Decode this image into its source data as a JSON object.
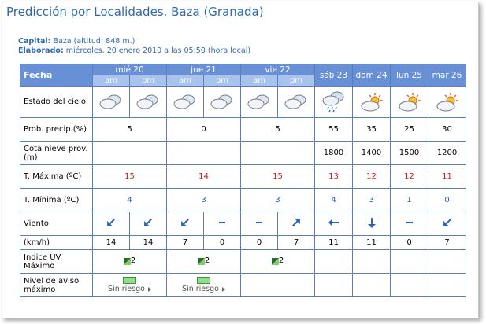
{
  "page": {
    "title": "Predicción por Localidades. Baza (Granada)",
    "capital_label": "Capital:",
    "capital_value": "Baza (altitud: 848 m.)",
    "elaborado_label": "Elaborado:",
    "elaborado_value": "miércoles, 20 enero 2010 a las 05:50 (hora local)"
  },
  "table": {
    "fecha_label": "Fecha",
    "split_days": [
      {
        "label": "mié 20",
        "am": "am",
        "pm": "pm"
      },
      {
        "label": "jue 21",
        "am": "am",
        "pm": "pm"
      },
      {
        "label": "vie 22",
        "am": "am",
        "pm": "pm"
      }
    ],
    "single_days": [
      "sáb 23",
      "dom 24",
      "lun 25",
      "mar 26"
    ],
    "row_labels": {
      "sky": "Estado del cielo",
      "precip": "Prob. precip.(%)",
      "snow": "Cota nieve prov.(m)",
      "tmax": "T. Máxima (ºC)",
      "tmin": "T. Mínima (ºC)",
      "wind": "Viento",
      "kmh": "(km/h)",
      "uv": "Indice UV Máximo",
      "warn": "Nivel de aviso máximo"
    },
    "sky_icons": [
      "cloudy-icon",
      "cloudy-icon",
      "cloudy-icon",
      "cloudy-icon",
      "cloudy-icon",
      "cloudy-icon",
      "cloudy-rain-icon",
      "partly-cloudy-sun-icon",
      "partly-cloudy-sun-icon",
      "partly-cloudy-sun-icon"
    ],
    "precip": [
      "5",
      "0",
      "5",
      "55",
      "35",
      "25",
      "30"
    ],
    "snow": [
      "",
      "",
      "",
      "1800",
      "1400",
      "1500",
      "1200"
    ],
    "tmax": [
      "15",
      "14",
      "15",
      "13",
      "12",
      "12",
      "11"
    ],
    "tmin": [
      "4",
      "3",
      "3",
      "4",
      "3",
      "1",
      "0"
    ],
    "wind_dirs": [
      "arrow-down-right",
      "arrow-down-right",
      "arrow-down-right",
      "calm",
      "calm",
      "arrow-up-left",
      "arrow-left",
      "arrow-down",
      "calm",
      "arrow-down-right"
    ],
    "wind_speed": [
      "14",
      "14",
      "7",
      "0",
      "0",
      "7",
      "11",
      "11",
      "0",
      "7"
    ],
    "uv": [
      "2",
      "2",
      "2"
    ],
    "warn_label": "Sin riesgo"
  },
  "colors": {
    "header": "#6790d7",
    "subheader": "#a9c3ef",
    "border": "#5a7fb8",
    "title": "#2e68b0",
    "temp_max": "#d4141b",
    "temp_min": "#2b5fa8",
    "warn_green": "#8fe08a"
  }
}
